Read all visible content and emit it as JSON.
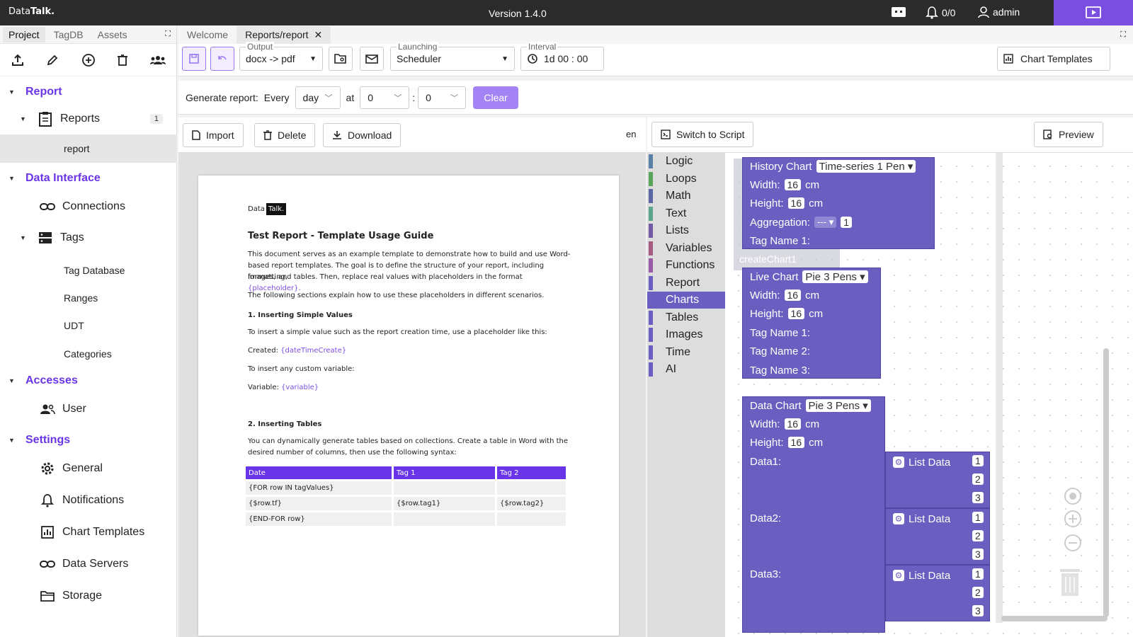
{
  "app": {
    "brand_a": "Data",
    "brand_b": "Talk.",
    "version": "Version 1.4.0",
    "alerts": "0/0",
    "user": "admin"
  },
  "left": {
    "tabs": [
      "Project",
      "TagDB",
      "Assets"
    ],
    "tree": {
      "report": "Report",
      "reports": "Reports",
      "reports_count": "1",
      "report_item": "report",
      "data_interface": "Data Interface",
      "connections": "Connections",
      "tags": "Tags",
      "tag_database": "Tag Database",
      "ranges": "Ranges",
      "udt": "UDT",
      "categories": "Categories",
      "accesses": "Accesses",
      "user": "User",
      "settings": "Settings",
      "general": "General",
      "notifications": "Notifications",
      "chart_templates": "Chart Templates",
      "data_servers": "Data Servers",
      "storage": "Storage"
    }
  },
  "tabs": [
    "Welcome",
    "Reports/report"
  ],
  "toolbar": {
    "output_label": "Output",
    "output_value": "docx -> pdf",
    "launching_label": "Launching",
    "launching_value": "Scheduler",
    "interval_label": "Interval",
    "interval_value": "1d 00 : 00",
    "chart_templates": "Chart Templates"
  },
  "generate": {
    "label": "Generate report:",
    "every": "Every",
    "period": "day",
    "at": "at",
    "hour": "0",
    "colon": ":",
    "minute": "0",
    "clear": "Clear"
  },
  "docbar": {
    "import": "Import",
    "delete": "Delete",
    "download": "Download",
    "lang": "en"
  },
  "doc": {
    "logo_a": "Data",
    "logo_b": "Talk.",
    "title": "Test Report - Template Usage Guide",
    "intro_1": "This document serves as an example template to demonstrate how to build and use Word-",
    "intro_2": "based report templates. The goal is to define the structure of your report, including formatting,",
    "intro_3": "images, and tables. Then, replace real values with placeholders in the format",
    "intro_ph": "{placeholder}.",
    "sections_intro": "The following sections explain how to use these placeholders in different scenarios.",
    "h1": "1. Inserting Simple Values",
    "p1": "To insert a simple value such as the report creation time, use a placeholder like this:",
    "created_label": "Created:",
    "created_ph": "{dateTimeCreate}",
    "p2": "To insert any custom variable:",
    "variable_label": "Variable:",
    "variable_ph": "{variable}",
    "h2": "2. Inserting Tables",
    "p3_1": "You can dynamically generate tables based on collections. Create a table in Word with the",
    "p3_2": "desired number of columns, then use the following syntax:",
    "table_headers": [
      "Date",
      "Tag 1",
      "Tag 2"
    ],
    "table_rows": [
      [
        "{FOR row IN tagValues}",
        "",
        ""
      ],
      [
        "{$row.tf}",
        "{$row.tag1}",
        "{$row.tag2}"
      ],
      [
        "{END-FOR row}",
        "",
        ""
      ]
    ]
  },
  "blockbar": {
    "switch": "Switch to Script",
    "preview": "Preview"
  },
  "toolbox": [
    "Logic",
    "Loops",
    "Math",
    "Text",
    "Lists",
    "Variables",
    "Functions",
    "Report",
    "Charts",
    "Tables",
    "Images",
    "Time",
    "AI"
  ],
  "toolbox_colors": [
    "#5b80a5",
    "#5ba55b",
    "#5b67a5",
    "#5ba58c",
    "#745ba5",
    "#a55b80",
    "#995ba5",
    "#6a5fc0",
    "#6a5fc0",
    "#6a5fc0",
    "#6a5fc0",
    "#6a5fc0",
    "#6a5fc0"
  ],
  "blocks": {
    "history": {
      "title": "History Chart",
      "type": "Time-series 1 Pen",
      "width_label": "Width:",
      "width": "16",
      "unit": "cm",
      "height_label": "Height:",
      "height": "16",
      "agg_label": "Aggregation:",
      "agg": "---",
      "agg_n": "1",
      "tag1": "Tag Name 1:",
      "ghost": "createChart1"
    },
    "live": {
      "title": "Live Chart",
      "type": "Pie 3 Pens",
      "width_label": "Width:",
      "width": "16",
      "unit": "cm",
      "height_label": "Height:",
      "height": "16",
      "tag1": "Tag Name 1:",
      "tag2": "Tag Name 2:",
      "tag3": "Tag Name 3:"
    },
    "data": {
      "title": "Data Chart",
      "type": "Pie 3 Pens",
      "width_label": "Width:",
      "width": "16",
      "unit": "cm",
      "height_label": "Height:",
      "height": "16",
      "d1": "Data1:",
      "d2": "Data2:",
      "d3": "Data3:",
      "list": "List Data",
      "n1": "1",
      "n2": "2",
      "n3": "3"
    }
  }
}
